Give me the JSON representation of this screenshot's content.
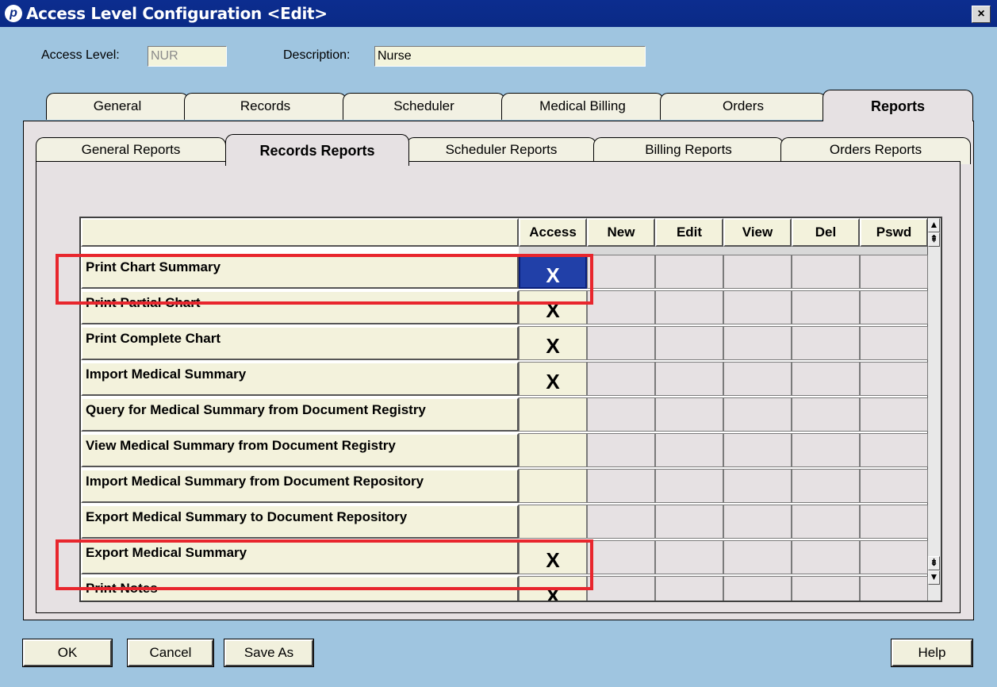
{
  "window": {
    "title": "Access Level Configuration <Edit>",
    "close_glyph": "×"
  },
  "form": {
    "access_level_label": "Access Level:",
    "access_level_value": "NUR",
    "description_label": "Description:",
    "description_value": "Nurse"
  },
  "main_tabs": [
    {
      "label": "General",
      "active": false
    },
    {
      "label": "Records",
      "active": false
    },
    {
      "label": "Scheduler",
      "active": false
    },
    {
      "label": "Medical Billing",
      "active": false
    },
    {
      "label": "Orders",
      "active": false
    },
    {
      "label": "Reports",
      "active": true
    }
  ],
  "sub_tabs": [
    {
      "label": "General Reports",
      "active": false
    },
    {
      "label": "Records Reports",
      "active": true
    },
    {
      "label": "Scheduler Reports",
      "active": false
    },
    {
      "label": "Billing Reports",
      "active": false
    },
    {
      "label": "Orders Reports",
      "active": false
    }
  ],
  "grid": {
    "columns": [
      "",
      "Access",
      "New",
      "Edit",
      "View",
      "Del",
      "Pswd"
    ],
    "rows": [
      {
        "name": "Print Chart Summary",
        "access": "X",
        "selected": true,
        "highlighted": true
      },
      {
        "name": "Print Partial Chart",
        "access": "X"
      },
      {
        "name": "Print Complete Chart",
        "access": "X"
      },
      {
        "name": "Import Medical Summary",
        "access": "X"
      },
      {
        "name": "Query for Medical Summary from Document Registry",
        "access": ""
      },
      {
        "name": "View Medical Summary from Document Registry",
        "access": ""
      },
      {
        "name": "Import Medical Summary from Document Repository",
        "access": ""
      },
      {
        "name": "Export Medical Summary to Document Repository",
        "access": ""
      },
      {
        "name": "Export Medical Summary",
        "access": "X",
        "highlighted": true
      },
      {
        "name": "Print Notes",
        "access": "X"
      }
    ]
  },
  "buttons": {
    "ok": "OK",
    "cancel": "Cancel",
    "save_as": "Save As",
    "help": "Help"
  },
  "colors": {
    "highlight": "#e8262d",
    "selected_cell": "#2140a8",
    "title_bar": "#0a2a86"
  }
}
